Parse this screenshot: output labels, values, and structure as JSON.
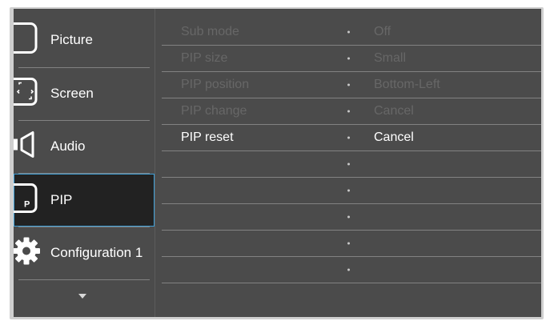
{
  "sidebar": {
    "items": [
      {
        "label": "Picture",
        "icon": "picture-icon"
      },
      {
        "label": "Screen",
        "icon": "screen-icon"
      },
      {
        "label": "Audio",
        "icon": "speaker-icon"
      },
      {
        "label": "PIP",
        "icon": "pip-icon",
        "icon_text": "P"
      },
      {
        "label": "Configuration 1",
        "icon": "gear-icon"
      }
    ],
    "selected_index": 3,
    "more_indicator": "chevron-down-icon"
  },
  "settings": {
    "rows": [
      {
        "name": "Sub mode",
        "value": "Off",
        "enabled": false
      },
      {
        "name": "PIP size",
        "value": "Small",
        "enabled": false
      },
      {
        "name": "PIP position",
        "value": "Bottom-Left",
        "enabled": false
      },
      {
        "name": "PIP change",
        "value": "Cancel",
        "enabled": false
      },
      {
        "name": "PIP reset",
        "value": "Cancel",
        "enabled": true
      },
      {
        "name": "",
        "value": "",
        "enabled": false
      },
      {
        "name": "",
        "value": "",
        "enabled": false
      },
      {
        "name": "",
        "value": "",
        "enabled": false
      },
      {
        "name": "",
        "value": "",
        "enabled": false
      },
      {
        "name": "",
        "value": "",
        "enabled": false
      }
    ]
  },
  "colors": {
    "panel_background": "#4b4b4b",
    "selected_background": "#222222",
    "selection_border": "#3fa0d8",
    "enabled_text": "#ffffff",
    "disabled_text": "#676767"
  }
}
